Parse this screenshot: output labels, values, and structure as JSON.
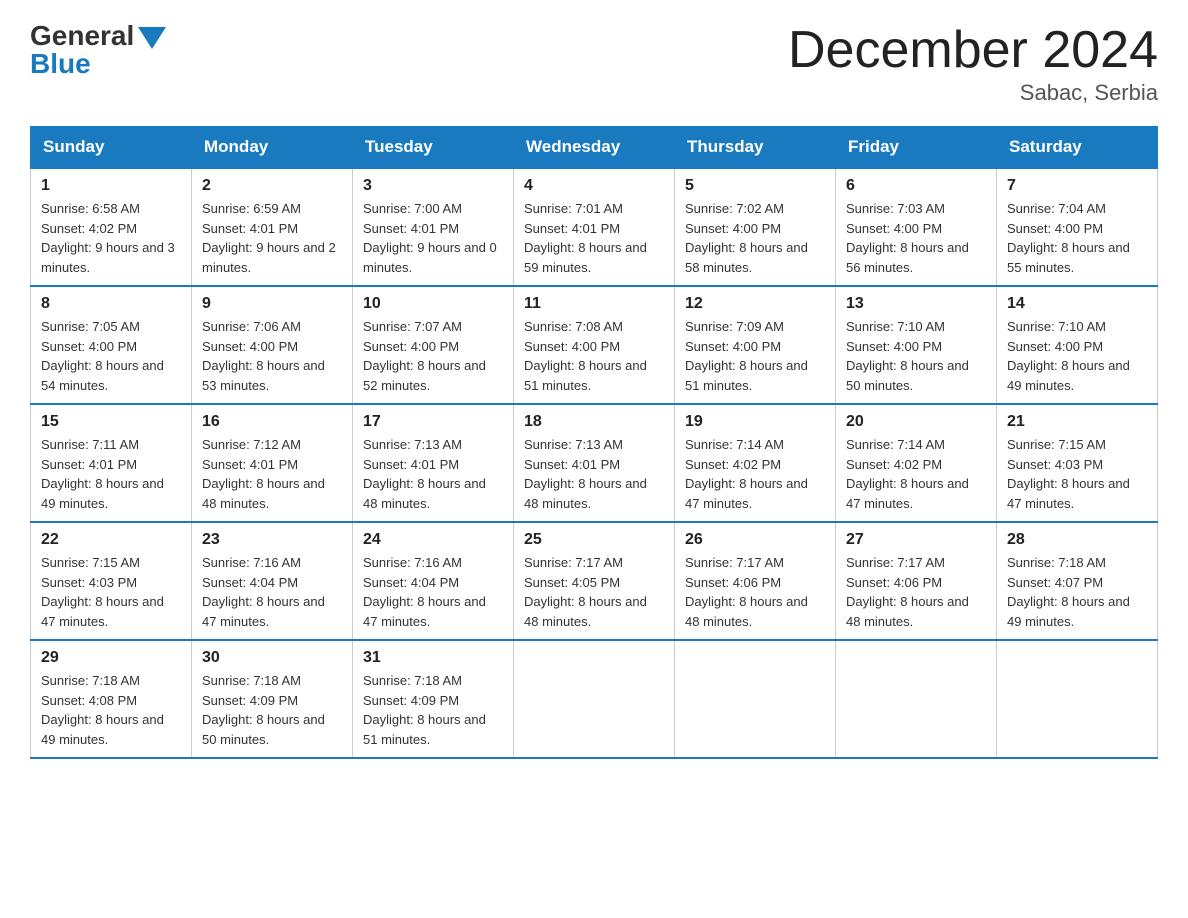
{
  "header": {
    "logo_general": "General",
    "logo_blue": "Blue",
    "month_title": "December 2024",
    "location": "Sabac, Serbia"
  },
  "days_of_week": [
    "Sunday",
    "Monday",
    "Tuesday",
    "Wednesday",
    "Thursday",
    "Friday",
    "Saturday"
  ],
  "weeks": [
    [
      {
        "day": "1",
        "sunrise": "6:58 AM",
        "sunset": "4:02 PM",
        "daylight": "9 hours and 3 minutes."
      },
      {
        "day": "2",
        "sunrise": "6:59 AM",
        "sunset": "4:01 PM",
        "daylight": "9 hours and 2 minutes."
      },
      {
        "day": "3",
        "sunrise": "7:00 AM",
        "sunset": "4:01 PM",
        "daylight": "9 hours and 0 minutes."
      },
      {
        "day": "4",
        "sunrise": "7:01 AM",
        "sunset": "4:01 PM",
        "daylight": "8 hours and 59 minutes."
      },
      {
        "day": "5",
        "sunrise": "7:02 AM",
        "sunset": "4:00 PM",
        "daylight": "8 hours and 58 minutes."
      },
      {
        "day": "6",
        "sunrise": "7:03 AM",
        "sunset": "4:00 PM",
        "daylight": "8 hours and 56 minutes."
      },
      {
        "day": "7",
        "sunrise": "7:04 AM",
        "sunset": "4:00 PM",
        "daylight": "8 hours and 55 minutes."
      }
    ],
    [
      {
        "day": "8",
        "sunrise": "7:05 AM",
        "sunset": "4:00 PM",
        "daylight": "8 hours and 54 minutes."
      },
      {
        "day": "9",
        "sunrise": "7:06 AM",
        "sunset": "4:00 PM",
        "daylight": "8 hours and 53 minutes."
      },
      {
        "day": "10",
        "sunrise": "7:07 AM",
        "sunset": "4:00 PM",
        "daylight": "8 hours and 52 minutes."
      },
      {
        "day": "11",
        "sunrise": "7:08 AM",
        "sunset": "4:00 PM",
        "daylight": "8 hours and 51 minutes."
      },
      {
        "day": "12",
        "sunrise": "7:09 AM",
        "sunset": "4:00 PM",
        "daylight": "8 hours and 51 minutes."
      },
      {
        "day": "13",
        "sunrise": "7:10 AM",
        "sunset": "4:00 PM",
        "daylight": "8 hours and 50 minutes."
      },
      {
        "day": "14",
        "sunrise": "7:10 AM",
        "sunset": "4:00 PM",
        "daylight": "8 hours and 49 minutes."
      }
    ],
    [
      {
        "day": "15",
        "sunrise": "7:11 AM",
        "sunset": "4:01 PM",
        "daylight": "8 hours and 49 minutes."
      },
      {
        "day": "16",
        "sunrise": "7:12 AM",
        "sunset": "4:01 PM",
        "daylight": "8 hours and 48 minutes."
      },
      {
        "day": "17",
        "sunrise": "7:13 AM",
        "sunset": "4:01 PM",
        "daylight": "8 hours and 48 minutes."
      },
      {
        "day": "18",
        "sunrise": "7:13 AM",
        "sunset": "4:01 PM",
        "daylight": "8 hours and 48 minutes."
      },
      {
        "day": "19",
        "sunrise": "7:14 AM",
        "sunset": "4:02 PM",
        "daylight": "8 hours and 47 minutes."
      },
      {
        "day": "20",
        "sunrise": "7:14 AM",
        "sunset": "4:02 PM",
        "daylight": "8 hours and 47 minutes."
      },
      {
        "day": "21",
        "sunrise": "7:15 AM",
        "sunset": "4:03 PM",
        "daylight": "8 hours and 47 minutes."
      }
    ],
    [
      {
        "day": "22",
        "sunrise": "7:15 AM",
        "sunset": "4:03 PM",
        "daylight": "8 hours and 47 minutes."
      },
      {
        "day": "23",
        "sunrise": "7:16 AM",
        "sunset": "4:04 PM",
        "daylight": "8 hours and 47 minutes."
      },
      {
        "day": "24",
        "sunrise": "7:16 AM",
        "sunset": "4:04 PM",
        "daylight": "8 hours and 47 minutes."
      },
      {
        "day": "25",
        "sunrise": "7:17 AM",
        "sunset": "4:05 PM",
        "daylight": "8 hours and 48 minutes."
      },
      {
        "day": "26",
        "sunrise": "7:17 AM",
        "sunset": "4:06 PM",
        "daylight": "8 hours and 48 minutes."
      },
      {
        "day": "27",
        "sunrise": "7:17 AM",
        "sunset": "4:06 PM",
        "daylight": "8 hours and 48 minutes."
      },
      {
        "day": "28",
        "sunrise": "7:18 AM",
        "sunset": "4:07 PM",
        "daylight": "8 hours and 49 minutes."
      }
    ],
    [
      {
        "day": "29",
        "sunrise": "7:18 AM",
        "sunset": "4:08 PM",
        "daylight": "8 hours and 49 minutes."
      },
      {
        "day": "30",
        "sunrise": "7:18 AM",
        "sunset": "4:09 PM",
        "daylight": "8 hours and 50 minutes."
      },
      {
        "day": "31",
        "sunrise": "7:18 AM",
        "sunset": "4:09 PM",
        "daylight": "8 hours and 51 minutes."
      },
      null,
      null,
      null,
      null
    ]
  ]
}
